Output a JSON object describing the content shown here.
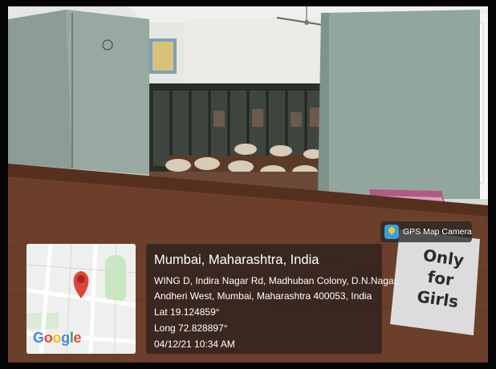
{
  "watermark": {
    "app_name": "GPS Map Camera",
    "map_logo": "Google"
  },
  "location": {
    "title": "Mumbai, Maharashtra, India",
    "address_line1": "WING D, Indira Nagar Rd, Madhuban Colony, D.N.Nagar,",
    "address_line2": "Andheri West, Mumbai, Maharashtra 400053, India",
    "lat": "Lat 19.124859°",
    "long": "Long 72.828897°",
    "datetime": "04/12/21 10:34 AM"
  },
  "sign": {
    "line1": "Only",
    "line2": "for",
    "line3": "Girls"
  },
  "colors": {
    "pin": "#e0453a",
    "wood": "#6b3f2a",
    "partition": "#8fa39a"
  }
}
